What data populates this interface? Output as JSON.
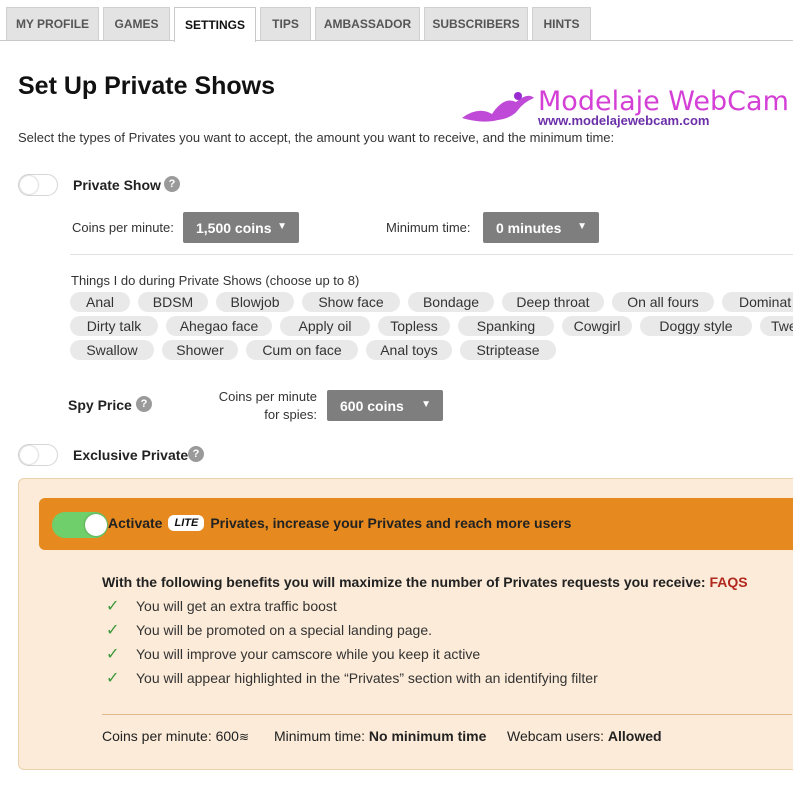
{
  "tabs": [
    {
      "label": "MY PROFILE",
      "active": false
    },
    {
      "label": "GAMES",
      "active": false
    },
    {
      "label": "SETTINGS",
      "active": true
    },
    {
      "label": "TIPS",
      "active": false
    },
    {
      "label": "AMBASSADOR",
      "active": false
    },
    {
      "label": "SUBSCRIBERS",
      "active": false
    },
    {
      "label": "HINTS",
      "active": false
    }
  ],
  "watermark": {
    "title": "Modelaje WebCam",
    "url": "www.modelajewebcam.com"
  },
  "page": {
    "title": "Set Up Private Shows",
    "description": "Select the types of Privates you want to accept, the amount you want to receive, and the minimum time:"
  },
  "private_show": {
    "label": "Private Show",
    "enabled": false,
    "help": "?",
    "coins_label": "Coins per minute:",
    "coins_value": "1,500 coins",
    "min_time_label": "Minimum time:",
    "min_time_value": "0 minutes"
  },
  "things": {
    "label": "Things I do during Private Shows (choose up to 8)",
    "items": [
      "Anal",
      "BDSM",
      "Blowjob",
      "Show face",
      "Bondage",
      "Deep throat",
      "On all fours",
      "Dominat",
      "Dirty talk",
      "Ahegao face",
      "Apply oil",
      "Topless",
      "Spanking",
      "Cowgirl",
      "Doggy style",
      "Twe",
      "Swallow",
      "Shower",
      "Cum on face",
      "Anal toys",
      "Striptease"
    ]
  },
  "spy": {
    "label": "Spy Price",
    "help": "?",
    "coins_label": "Coins per minute for spies:",
    "coins_value": "600 coins"
  },
  "exclusive": {
    "label": "Exclusive Private",
    "enabled": false,
    "help": "?"
  },
  "lite": {
    "enabled": true,
    "text_before": "Activate",
    "badge": "LITE",
    "text_after": "Privates, increase your Privates and reach more users",
    "benefits_title": "With the following benefits you will maximize the number of Privates requests you receive:",
    "faqs_label": "FAQS",
    "benefits": [
      "You will get an extra traffic boost",
      "You will be promoted on a special landing page.",
      "You will improve your camscore while you keep it active",
      "You will appear highlighted in the “Privates” section with an identifying filter"
    ],
    "footer": {
      "coins_label": "Coins per minute:",
      "coins_value": "600",
      "min_label": "Minimum time:",
      "min_value": "No minimum time",
      "webcam_label": "Webcam users:",
      "webcam_value": "Allowed"
    }
  },
  "colors": {
    "accent_orange": "#e68a1f",
    "promo_bg": "#fbebd8",
    "toggle_on": "#6fcf6a",
    "select_bg": "#7e7e7e",
    "faqs": "#b3281e",
    "check": "#3a9a3a",
    "watermark": "#d43fd6"
  },
  "icons": {
    "help": "question-circle-icon",
    "check": "check-icon",
    "caret": "caret-down-icon",
    "coin": "coin-icon"
  }
}
